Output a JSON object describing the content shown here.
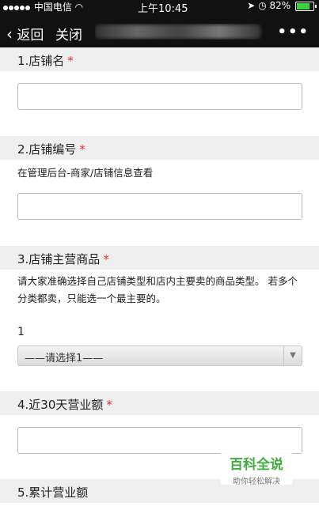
{
  "status": {
    "carrier": "中国电信",
    "time": "上午10:45",
    "battery": "82%",
    "battery_level": 0.82
  },
  "nav": {
    "back_label": "返回",
    "close_label": "关闭",
    "more_label": "•••"
  },
  "fields": [
    {
      "label": "1.店铺名",
      "required": "*"
    },
    {
      "label": "2.店铺编号",
      "required": "*",
      "desc": "在管理后台-商家/店铺信息查看"
    },
    {
      "label": "3.店铺主营商品",
      "required": "*",
      "desc": "请大家准确选择自己店铺类型和店内主要卖的商品类型。 若多个分类都卖，只能选一个最主要的。",
      "sub_label": "1",
      "select_value": "——请选择1——"
    },
    {
      "label": "4.近30天营业额",
      "required": "*"
    },
    {
      "label": "5.累计营业额"
    }
  ],
  "watermark": {
    "title": "百科全说",
    "subtitle": "助你轻松解决"
  }
}
